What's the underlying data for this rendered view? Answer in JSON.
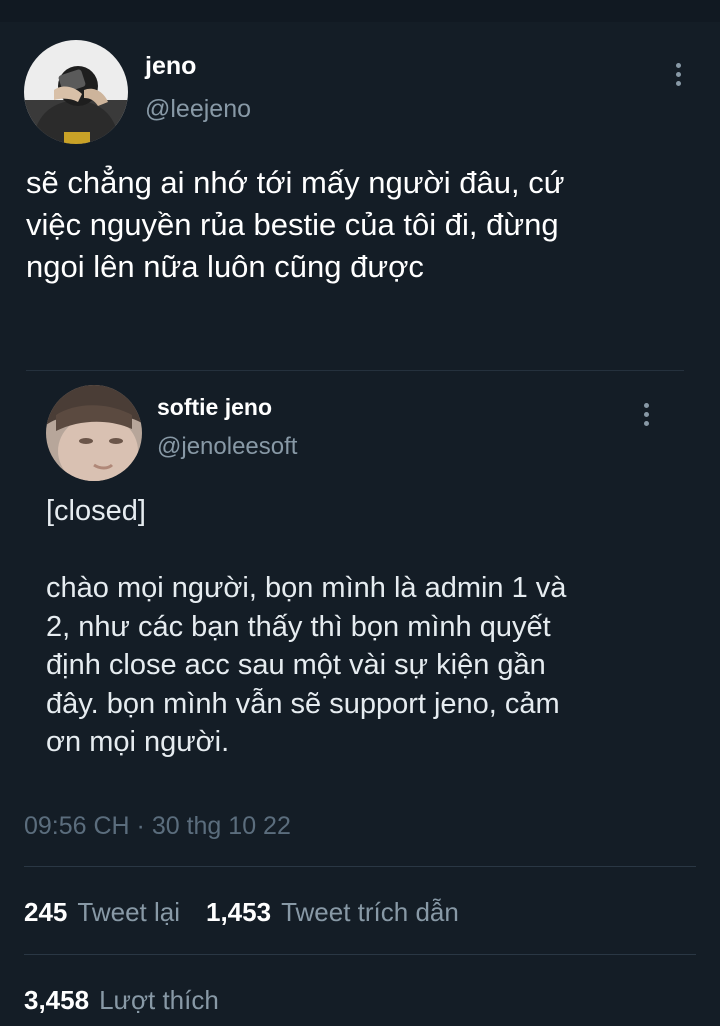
{
  "tweet": {
    "author": {
      "name": "jeno",
      "handle": "@leejeno"
    },
    "text": "sẽ chẳng ai nhớ tới mấy người đâu, cứ\nviệc nguyền rủa bestie của tôi đi, đừng\nngoi lên nữa luôn cũng được",
    "quoted": {
      "author": {
        "name": "softie jeno",
        "handle": "@jenoleesoft"
      },
      "text": "[closed]\n\nchào mọi người, bọn mình là admin 1 và\n2, như các bạn thấy thì bọn mình quyết\nđịnh close acc sau một vài sự kiện gần\nđây. bọn mình vẫn sẽ support jeno, cảm\nơn mọi người."
    },
    "timestamp": "09:56 CH · 30 thg 10 22",
    "stats": {
      "retweets": {
        "count": "245",
        "label": "Tweet lại"
      },
      "quotes": {
        "count": "1,453",
        "label": "Tweet trích dẫn"
      },
      "likes": {
        "count": "3,458",
        "label": "Lượt thích"
      }
    }
  },
  "icons": {
    "more": "vertical-ellipsis-icon"
  },
  "colors": {
    "background": "#141d26",
    "primary_text": "#ffffff",
    "secondary_text": "#8899a6",
    "timestamp_text": "#5b6d7d",
    "divider": "#2a3744"
  }
}
